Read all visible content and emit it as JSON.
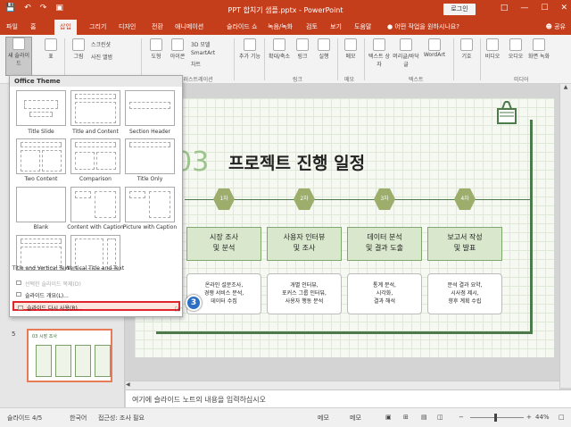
{
  "titlebar": {
    "doc_title": "PPT 합치기 샘플.pptx - PowerPoint",
    "login_label": "로그인",
    "qat_icons": [
      "save-icon",
      "undo-icon",
      "redo-icon",
      "present-icon"
    ],
    "window_buttons": [
      "restore-ribbon-icon",
      "minimize-icon",
      "maximize-icon",
      "close-icon"
    ]
  },
  "menubar": {
    "tabs": [
      "파일",
      "홈",
      "삽입",
      "그리기",
      "디자인",
      "전환",
      "애니메이션",
      "슬라이드 쇼",
      "녹음/녹화",
      "검토",
      "보기",
      "도움말"
    ],
    "active_tab": "삽입",
    "tell_me": "어떤 작업을 원하시나요?",
    "share_label": "공유"
  },
  "ribbon": {
    "new_slide_label": "새 슬라이드",
    "table_label": "표",
    "images_label": "그림",
    "screenshot_label": "스크린샷",
    "photo_album_label": "사진 앨범",
    "shapes_label": "도형",
    "icons_label": "아이콘",
    "models_label": "3D 모델",
    "smartart_label": "SmartArt",
    "chart_label": "차트",
    "addins_label": "추가 기능",
    "zoom_label": "확대/축소",
    "link_label": "링크",
    "action_label": "실행",
    "comment_label": "메모",
    "textbox_label": "텍스트 상자",
    "headerfooter_label": "머리글/바닥글",
    "wordart_label": "WordArt",
    "symbols_label": "기호",
    "media_label": "미디어",
    "video_label": "비디오",
    "audio_label": "오디오",
    "screen_rec_label": "화면 녹화",
    "groups": {
      "illustrations": "일러스트레이션",
      "links": "링크",
      "comments": "메모",
      "text": "텍스트",
      "media": "미디어"
    }
  },
  "layout_dropdown": {
    "header": "Office Theme",
    "layouts": [
      "Title Slide",
      "Title and Content",
      "Section Header",
      "Two Content",
      "Comparison",
      "Title Only",
      "Blank",
      "Content with Caption",
      "Picture with Caption",
      "Title and Vertical Text",
      "Vertical Title and Text"
    ],
    "menu_items": [
      "선택한 슬라이드 복제(D)",
      "슬라이드 개요(L)...",
      "슬라이드 다시 사용(R)..."
    ],
    "step_badge": "3"
  },
  "thumbs": {
    "slide_number": "5",
    "thumb_title": "03 시장 조사"
  },
  "slide": {
    "number": "03",
    "title": "프로젝트 진행 일정",
    "hex_labels": [
      "1차",
      "2차",
      "3차",
      "4차"
    ],
    "steps": [
      {
        "line1": "시장 조사",
        "line2": "및 분석"
      },
      {
        "line1": "사용자 인터뷰",
        "line2": "및 조사"
      },
      {
        "line1": "데이터 분석",
        "line2": "및 결과 도출"
      },
      {
        "line1": "보고서 작성",
        "line2": "및 발표"
      }
    ],
    "details": [
      {
        "l1": "온라인 설문조사,",
        "l2": "경쟁 서비스 분석,",
        "l3": "데이터 수집"
      },
      {
        "l1": "개별 인터뷰,",
        "l2": "포커스 그룹 인터뷰,",
        "l3": "사용자 행동 분석"
      },
      {
        "l1": "통계 분석,",
        "l2": "시각화,",
        "l3": "결과 해석"
      },
      {
        "l1": "분석 결과 요약,",
        "l2": "시사점 제시,",
        "l3": "향후 계획 수립"
      }
    ]
  },
  "notes_placeholder": "여기에 슬라이드 노트의 내용을 입력하십시오",
  "status": {
    "slide_info": "슬라이드 4/5",
    "language": "한국어",
    "accessibility": "접근성: 조사 필요",
    "notes": "메모",
    "comments": "메모",
    "zoom": "44%",
    "zoom_level": 0.44
  },
  "colors": {
    "accent": "#c43e1c",
    "slide_green": "#4d7a4a",
    "hex_olive": "#9cad6c",
    "highlight_red": "#e0262c",
    "badge_blue": "#2b6fc5"
  }
}
